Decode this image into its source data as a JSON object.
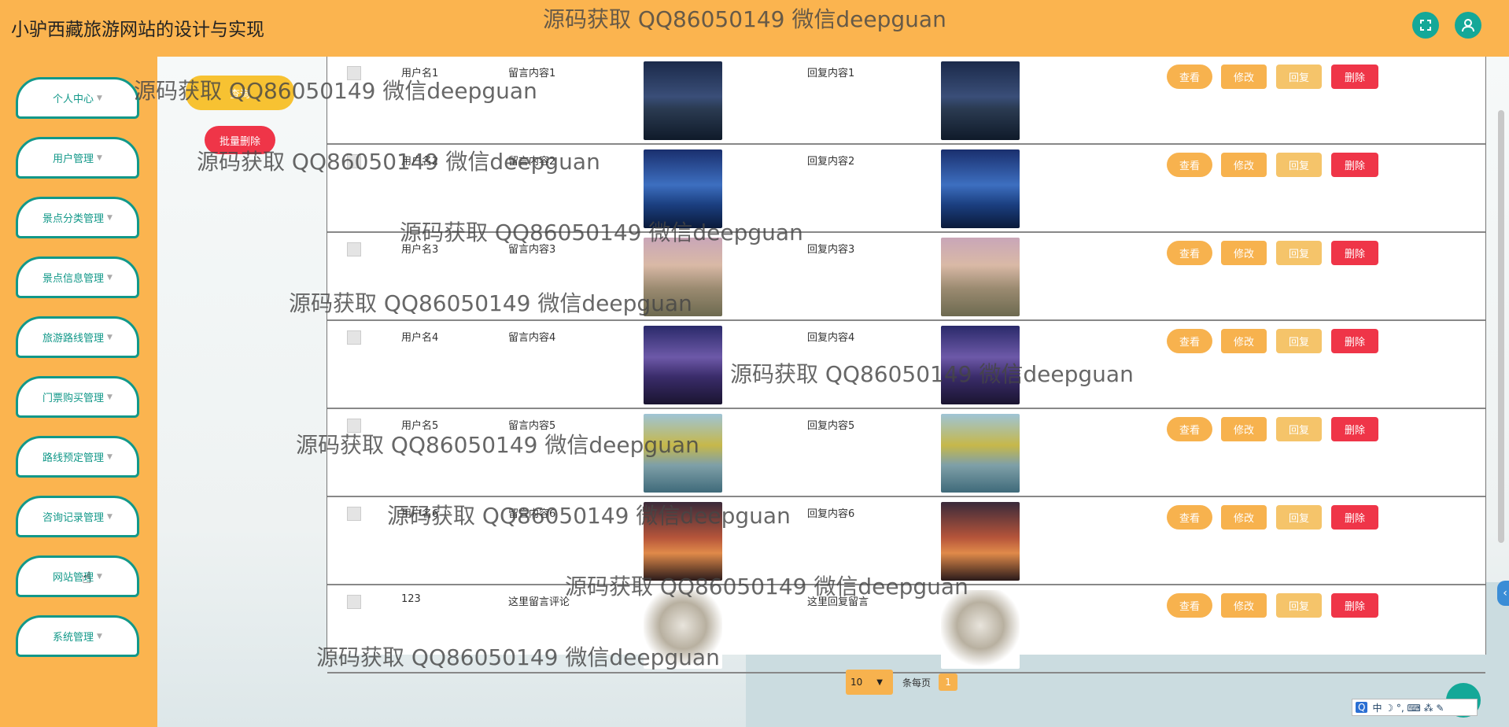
{
  "header": {
    "title": "小驴西藏旅游网站的设计与实现",
    "fullscreen_icon": "expand-icon",
    "user_icon": "user-icon"
  },
  "sidebar": {
    "items": [
      {
        "label": "个人中心"
      },
      {
        "label": "用户管理"
      },
      {
        "label": "景点分类管理"
      },
      {
        "label": "景点信息管理"
      },
      {
        "label": "旅游路线管理"
      },
      {
        "label": "门票购买管理"
      },
      {
        "label": "路线预定管理"
      },
      {
        "label": "咨询记录管理"
      },
      {
        "label": "网站管理"
      },
      {
        "label": "系统管理"
      }
    ]
  },
  "toolbar": {
    "search_label": "查询",
    "batch_delete_label": "批量删除"
  },
  "table": {
    "rows": [
      {
        "username": "用户名1",
        "message": "留言内容1",
        "reply": "回复内容1",
        "scene": "dusk-lake"
      },
      {
        "username": "用户名2",
        "message": "留言内容2",
        "reply": "回复内容2",
        "scene": "blue-lake"
      },
      {
        "username": "用户名3",
        "message": "留言内容3",
        "reply": "回复内容3",
        "scene": "flower-path"
      },
      {
        "username": "用户名4",
        "message": "留言内容4",
        "reply": "回复内容4",
        "scene": "night-pier"
      },
      {
        "username": "用户名5",
        "message": "留言内容5",
        "reply": "回复内容5",
        "scene": "lakeside-tree"
      },
      {
        "username": "用户名6",
        "message": "留言内容6",
        "reply": "回复内容6",
        "scene": "sunset-girl"
      },
      {
        "username": "123",
        "message": "这里留言评论",
        "reply": "这里回复留言",
        "scene": "cartoon-avatar"
      }
    ],
    "actions": {
      "view": "查看",
      "edit": "修改",
      "reply": "回复",
      "delete": "删除"
    }
  },
  "pagination": {
    "page_size": "10",
    "per_page_label": "条每页",
    "current_page": "1"
  },
  "watermark": "源码获取 QQ86050149 微信deepguan",
  "ime_bar": "中 ☽ °‚ ⌨ ⁂ ✎",
  "colors": {
    "accent": "#fbb44f",
    "teal": "#129889",
    "danger": "#ef3548"
  }
}
